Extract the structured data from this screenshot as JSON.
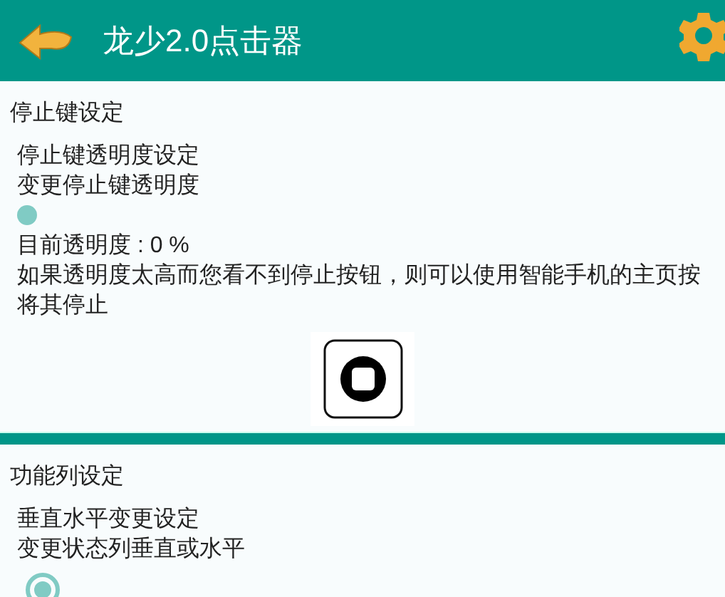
{
  "app_bar": {
    "title": "龙少2.0点击器"
  },
  "stop_section": {
    "heading": "停止键设定",
    "setting_title": "停止键透明度设定",
    "setting_desc": "变更停止键透明度",
    "slider": {
      "level": 0
    },
    "current": "目前透明度 : 0 %",
    "notice_lines": [
      "如果透明度太高而您看不到停止按钮，则可以使用智能手机的主页按",
      "将其停止"
    ]
  },
  "toolbar_section": {
    "heading": "功能列设定",
    "setting_title": "垂直水平变更设定",
    "setting_desc": "变更状态列垂直或水平",
    "radio": {
      "selected": true
    }
  }
}
